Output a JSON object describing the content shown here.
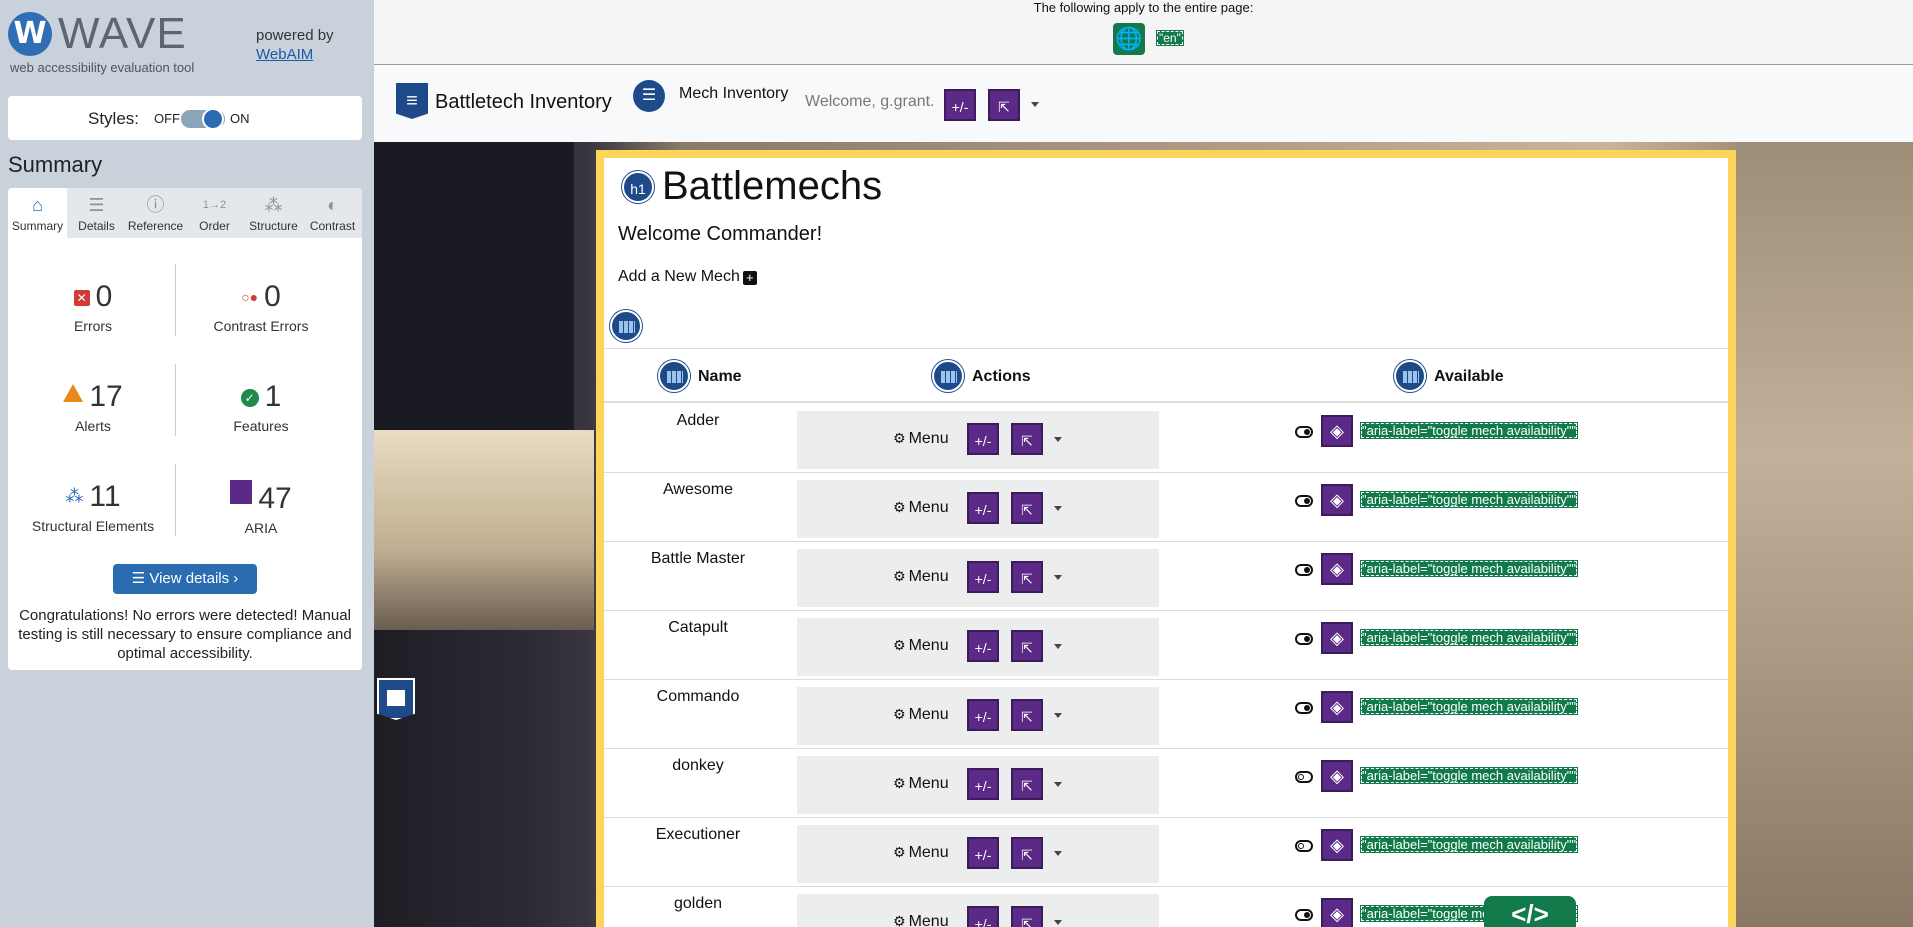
{
  "wave": {
    "logo_letter": "W",
    "title": "WAVE",
    "subtitle": "web accessibility evaluation tool",
    "powered_by": "powered by",
    "webaim_link": "WebAIM",
    "styles_label": "Styles:",
    "styles_off": "OFF",
    "styles_on": "ON",
    "summary_title": "Summary",
    "tabs": [
      {
        "label": "Summary",
        "icon": "home-icon"
      },
      {
        "label": "Details",
        "icon": "list-icon"
      },
      {
        "label": "Reference",
        "icon": "info-icon"
      },
      {
        "label": "Order",
        "icon": "order-icon"
      },
      {
        "label": "Structure",
        "icon": "structure-icon"
      },
      {
        "label": "Contrast",
        "icon": "contrast-icon"
      }
    ],
    "stats": {
      "errors": {
        "count": "0",
        "label": "Errors"
      },
      "contrast_errors": {
        "count": "0",
        "label": "Contrast Errors"
      },
      "alerts": {
        "count": "17",
        "label": "Alerts"
      },
      "features": {
        "count": "1",
        "label": "Features"
      },
      "structural": {
        "count": "11",
        "label": "Structural Elements"
      },
      "aria": {
        "count": "47",
        "label": "ARIA"
      }
    },
    "view_details": "View details ›",
    "congrats": "Congratulations! No errors were detected! Manual testing is still necessary to ensure compliance and optimal accessibility."
  },
  "page_notes": {
    "text": "The following apply to the entire page:",
    "lang": "\"en\""
  },
  "navbar": {
    "brand": "Battletech Inventory",
    "mech_inventory": "Mech Inventory",
    "welcome": "Welcome, g.grant.",
    "plus_minus": "+/-"
  },
  "content": {
    "h1_badge": "h1",
    "title": "Battlemechs",
    "welcome": "Welcome Commander!",
    "add_mech": "Add a New Mech",
    "columns": [
      "Name",
      "Actions",
      "Available"
    ],
    "menu_label": "Menu",
    "plus_minus": "+/-",
    "aria_label_text": "\"aria-label=\"toggle mech availability\"\"",
    "rows": [
      {
        "name": "Adder",
        "available": true
      },
      {
        "name": "Awesome",
        "available": true
      },
      {
        "name": "Battle Master",
        "available": true
      },
      {
        "name": "Catapult",
        "available": true
      },
      {
        "name": "Commando",
        "available": true
      },
      {
        "name": "donkey",
        "available": false
      },
      {
        "name": "Executioner",
        "available": false
      },
      {
        "name": "golden",
        "available": true
      }
    ]
  },
  "code_button": "</>"
}
